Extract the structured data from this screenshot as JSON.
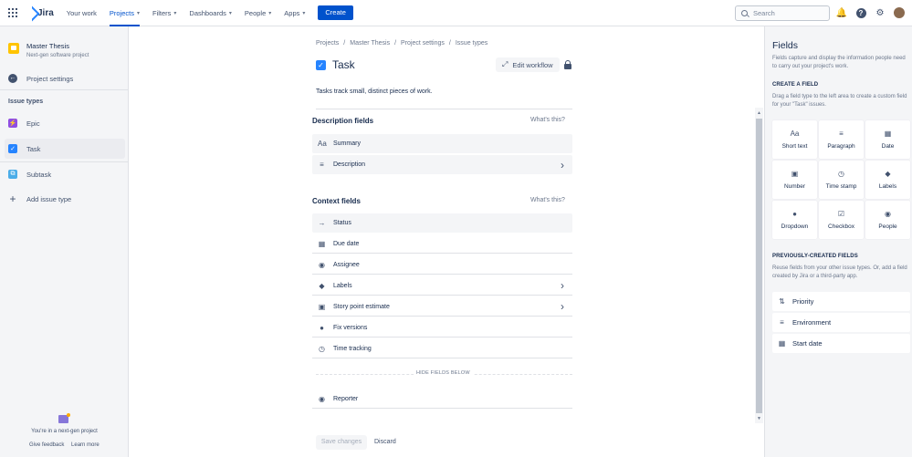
{
  "topnav": {
    "logo": "Jira",
    "items": [
      {
        "label": "Your work",
        "chevron": false,
        "active": false
      },
      {
        "label": "Projects",
        "chevron": true,
        "active": true
      },
      {
        "label": "Filters",
        "chevron": true,
        "active": false
      },
      {
        "label": "Dashboards",
        "chevron": true,
        "active": false
      },
      {
        "label": "People",
        "chevron": true,
        "active": false
      },
      {
        "label": "Apps",
        "chevron": true,
        "active": false
      }
    ],
    "create_label": "Create",
    "search_placeholder": "Search"
  },
  "sidebar": {
    "project_name": "Master Thesis",
    "project_type": "Next-gen software project",
    "back_label": "Project settings",
    "section_heading": "Issue types",
    "issue_types": [
      {
        "label": "Epic",
        "icon": "epic-icon",
        "selected": false
      },
      {
        "label": "Task",
        "icon": "task-icon",
        "selected": true
      },
      {
        "label": "Subtask",
        "icon": "subtask-icon",
        "selected": false
      }
    ],
    "add_label": "Add issue type",
    "footer_text": "You're in a next-gen project",
    "feedback_label": "Give feedback",
    "learn_more_label": "Learn more"
  },
  "main": {
    "breadcrumb": [
      "Projects",
      "Master Thesis",
      "Project settings",
      "Issue types"
    ],
    "title": "Task",
    "edit_workflow_label": "Edit workflow",
    "description": "Tasks track small, distinct pieces of work.",
    "description_fields": {
      "title": "Description fields",
      "help": "What's this?",
      "fields": [
        {
          "label": "Summary",
          "icon": "Aa",
          "chevron": false
        },
        {
          "label": "Description",
          "icon": "≡",
          "chevron": true
        }
      ]
    },
    "context_fields": {
      "title": "Context fields",
      "help": "What's this?",
      "fields": [
        {
          "label": "Status",
          "icon": "→",
          "chevron": false
        },
        {
          "label": "Due date",
          "icon": "▦",
          "chevron": false
        },
        {
          "label": "Assignee",
          "icon": "◉",
          "chevron": false
        },
        {
          "label": "Labels",
          "icon": "◆",
          "chevron": true
        },
        {
          "label": "Story point estimate",
          "icon": "▣",
          "chevron": true
        },
        {
          "label": "Fix versions",
          "icon": "●",
          "chevron": false
        },
        {
          "label": "Time tracking",
          "icon": "◷",
          "chevron": false
        }
      ],
      "hide_label": "HIDE FIELDS BELOW",
      "hidden_fields": [
        {
          "label": "Reporter",
          "icon": "◉"
        }
      ]
    },
    "save_label": "Save changes",
    "discard_label": "Discard"
  },
  "panel": {
    "title": "Fields",
    "description": "Fields capture and display the information people need to carry out your project's work.",
    "create_heading": "CREATE A FIELD",
    "create_description": "Drag a field type to the left area to create a custom field for your \"Task\" issues.",
    "field_types": [
      {
        "label": "Short text",
        "icon": "Aa"
      },
      {
        "label": "Paragraph",
        "icon": "≡"
      },
      {
        "label": "Date",
        "icon": "▦"
      },
      {
        "label": "Number",
        "icon": "▣"
      },
      {
        "label": "Time stamp",
        "icon": "◷"
      },
      {
        "label": "Labels",
        "icon": "◆"
      },
      {
        "label": "Dropdown",
        "icon": "●"
      },
      {
        "label": "Checkbox",
        "icon": "☑"
      },
      {
        "label": "People",
        "icon": "◉"
      }
    ],
    "previous_heading": "PREVIOUSLY-CREATED FIELDS",
    "previous_description": "Reuse fields from your other issue types. Or, add a field created by Jira or a third-party app.",
    "previous_fields": [
      {
        "label": "Priority",
        "icon": "⇅"
      },
      {
        "label": "Environment",
        "icon": "≡"
      },
      {
        "label": "Start date",
        "icon": "▦"
      }
    ]
  }
}
